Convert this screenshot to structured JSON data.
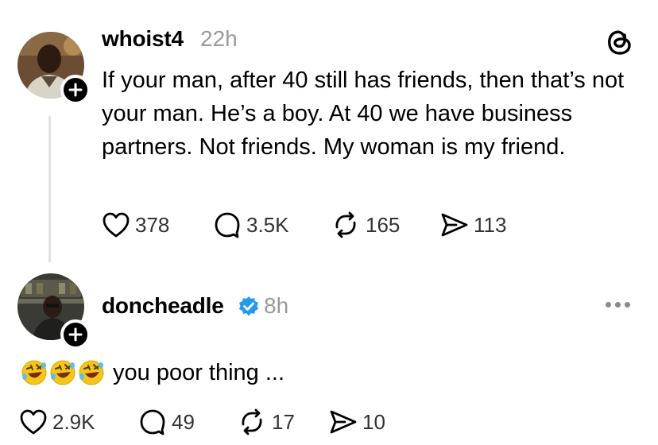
{
  "post": {
    "username": "whoist4",
    "time": "22h",
    "text": "If your man, after 40 still has friends, then that’s not your man. He’s a boy. At 40 we have business partners. Not friends. My woman is my friend.",
    "likes": "378",
    "replies": "3.5K",
    "reposts": "165",
    "shares": "113"
  },
  "reply": {
    "username": "doncheadle",
    "time": "8h",
    "verified": true,
    "emojis": [
      "rolling-on-floor-laughing",
      "rolling-on-floor-laughing",
      "rolling-on-floor-laughing"
    ],
    "text": "you poor thing ...",
    "likes": "2.9K",
    "replies": "49",
    "reposts": "17",
    "shares": "10"
  },
  "colors": {
    "text": "#000000",
    "muted": "#9a9a9a",
    "verified": "#1d9bf0",
    "thread_line": "#e2e2e2"
  }
}
